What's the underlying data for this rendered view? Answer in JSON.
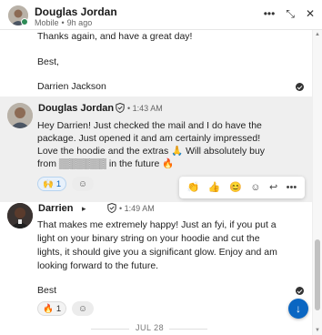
{
  "header": {
    "name": "Douglas Jordan",
    "device": "Mobile",
    "separator": "•",
    "time_ago": "9h ago",
    "icons": [
      "more-icon",
      "collapse-icon",
      "close-icon"
    ]
  },
  "previous_message": {
    "lines": [
      "Thanks again, and have a great day!",
      "",
      "Best,",
      "",
      "Darrien Jackson"
    ]
  },
  "message_douglas": {
    "sender": "Douglas Jordan",
    "separator": "•",
    "time": "1:43 AM",
    "lines": [
      "Hey Darrien! Just checked the mail and I do have the",
      "package. Just opened it and am certainly impressed!",
      "Love the hoodie and the extras 🙏 Will absolutely buy",
      "from ▒▒▒▒▒▒▒ in the future 🔥"
    ],
    "reaction": {
      "emoji": "🙌",
      "count": "1"
    }
  },
  "hover_actions": [
    "celebrate-icon",
    "like-icon",
    "smile-icon",
    "add-reaction-icon",
    "reply-icon",
    "more-icon"
  ],
  "message_darrien": {
    "sender": "Darrien",
    "separator": "•",
    "time": "1:49 AM",
    "lines": [
      "That makes me extremely happy! Just an fyi, if you put a",
      "light on your binary string on your hoodie and cut the",
      "lights, it should give you a significant glow. Enjoy and am",
      "looking forward to the future."
    ],
    "signoff": "Best",
    "reaction": {
      "emoji": "🔥",
      "count": "1"
    }
  },
  "date_divider": "JUL 28",
  "colors": {
    "accent": "#0a66c2",
    "presence": "#2e8b57",
    "highlight": "#efefef"
  }
}
